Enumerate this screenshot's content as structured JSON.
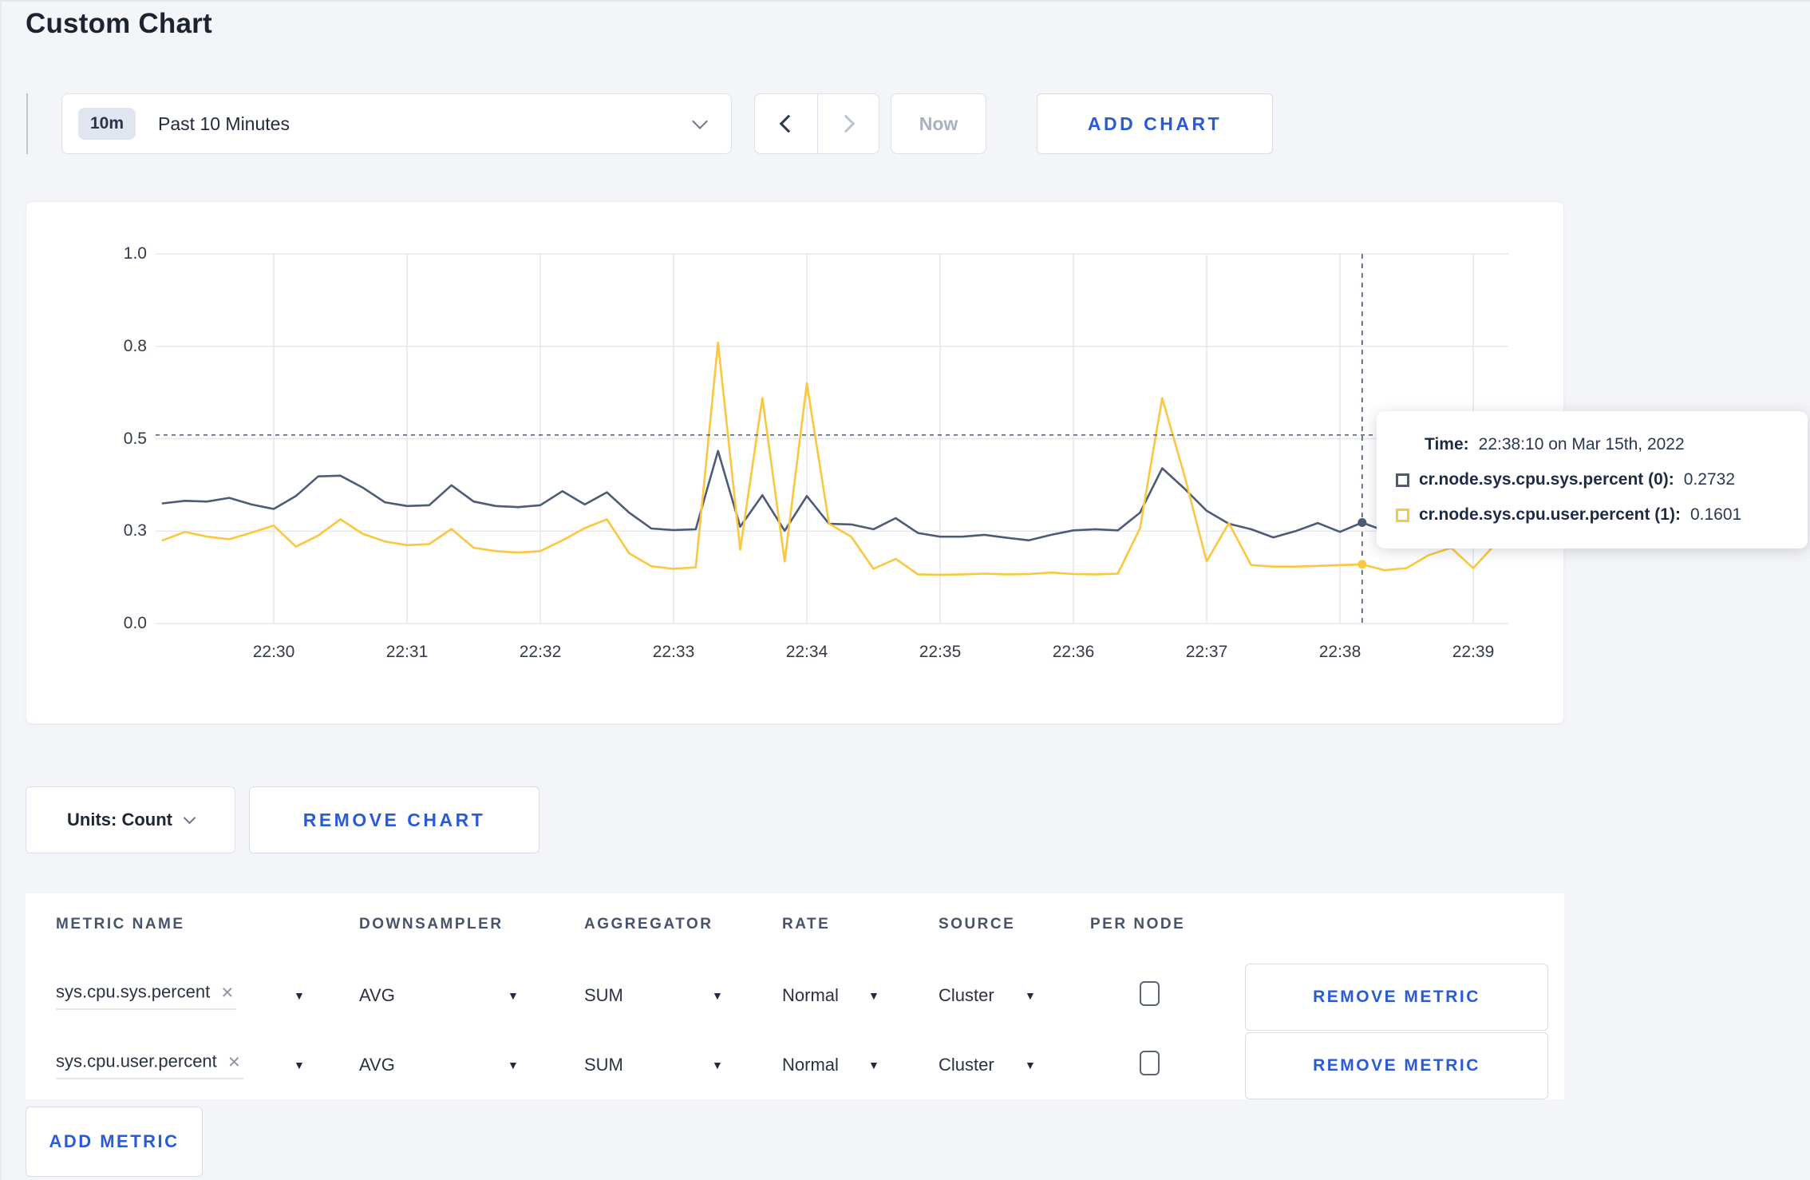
{
  "page": {
    "title": "Custom Chart"
  },
  "toolbar": {
    "time_badge": "10m",
    "time_label": "Past 10 Minutes",
    "now_label": "Now",
    "add_chart_label": "ADD CHART",
    "icons": {
      "prev": "chevron-left",
      "next": "chevron-right",
      "dropdown": "chevron-down"
    }
  },
  "chart_data": {
    "type": "line",
    "title": "",
    "xlabel": "",
    "ylabel": "",
    "ylim": [
      0,
      1
    ],
    "grid": true,
    "x_start": "22:29:10",
    "x_interval_seconds": 10,
    "first_tick_offset_seconds": 50,
    "tick_interval_seconds": 60,
    "x_tick_labels": [
      "22:30",
      "22:31",
      "22:32",
      "22:33",
      "22:34",
      "22:35",
      "22:36",
      "22:37",
      "22:38",
      "22:39"
    ],
    "y_tick_labels": [
      "0.0",
      "0.3",
      "0.5",
      "0.8",
      "1.0"
    ],
    "y_tick_fractions": [
      0,
      0.25,
      0.5,
      0.75,
      1.0
    ],
    "series": [
      {
        "name": "cr.node.sys.cpu.sys.percent (0)",
        "color": "#4e5b76",
        "values": [
          0.325,
          0.332,
          0.33,
          0.34,
          0.322,
          0.31,
          0.345,
          0.398,
          0.4,
          0.368,
          0.328,
          0.318,
          0.32,
          0.374,
          0.33,
          0.318,
          0.315,
          0.32,
          0.358,
          0.322,
          0.355,
          0.3,
          0.257,
          0.253,
          0.255,
          0.467,
          0.262,
          0.347,
          0.251,
          0.345,
          0.27,
          0.268,
          0.255,
          0.285,
          0.245,
          0.235,
          0.235,
          0.24,
          0.232,
          0.225,
          0.24,
          0.252,
          0.255,
          0.252,
          0.3,
          0.42,
          0.365,
          0.305,
          0.27,
          0.255,
          0.233,
          0.25,
          0.272,
          0.248,
          0.2732,
          0.251,
          0.27,
          0.24,
          0.245,
          0.255,
          0.26
        ]
      },
      {
        "name": "cr.node.sys.cpu.user.percent (1)",
        "color": "#fcc73f",
        "values": [
          0.225,
          0.248,
          0.235,
          0.228,
          0.246,
          0.265,
          0.208,
          0.238,
          0.282,
          0.243,
          0.222,
          0.212,
          0.215,
          0.256,
          0.205,
          0.196,
          0.192,
          0.196,
          0.225,
          0.258,
          0.282,
          0.19,
          0.155,
          0.148,
          0.152,
          0.76,
          0.2,
          0.61,
          0.168,
          0.65,
          0.27,
          0.235,
          0.148,
          0.175,
          0.133,
          0.132,
          0.133,
          0.135,
          0.133,
          0.134,
          0.138,
          0.134,
          0.133,
          0.135,
          0.258,
          0.61,
          0.4,
          0.168,
          0.272,
          0.158,
          0.154,
          0.154,
          0.156,
          0.158,
          0.1601,
          0.144,
          0.15,
          0.185,
          0.205,
          0.15,
          0.215
        ]
      }
    ],
    "crosshair": {
      "time": "22:38:10",
      "x_offset_seconds": 540,
      "hline_value": 0.51,
      "point_values": [
        0.2732,
        0.1601
      ]
    },
    "legend_position": "tooltip"
  },
  "tooltip": {
    "time_label": "Time:",
    "time_value": "22:38:10 on Mar 15th, 2022",
    "rows": [
      {
        "label": "cr.node.sys.cpu.sys.percent (0):",
        "value": "0.2732",
        "color": "#252f49"
      },
      {
        "label": "cr.node.sys.cpu.user.percent (1):",
        "value": "0.1601",
        "color": "#fcc73f"
      }
    ]
  },
  "chart_controls": {
    "units_label": "Units: Count",
    "remove_chart_label": "REMOVE CHART"
  },
  "metrics_table": {
    "columns": [
      "METRIC NAME",
      "DOWNSAMPLER",
      "AGGREGATOR",
      "RATE",
      "SOURCE",
      "PER NODE"
    ],
    "remove_x_icon": "×",
    "caret_icon": "▼",
    "rows": [
      {
        "name": "sys.cpu.sys.percent",
        "downsampler": "AVG",
        "aggregator": "SUM",
        "rate": "Normal",
        "source": "Cluster",
        "per_node_checked": false,
        "remove_label": "REMOVE METRIC"
      },
      {
        "name": "sys.cpu.user.percent",
        "downsampler": "AVG",
        "aggregator": "SUM",
        "rate": "Normal",
        "source": "Cluster",
        "per_node_checked": false,
        "remove_label": "REMOVE METRIC"
      }
    ],
    "add_metric_label": "ADD METRIC"
  }
}
